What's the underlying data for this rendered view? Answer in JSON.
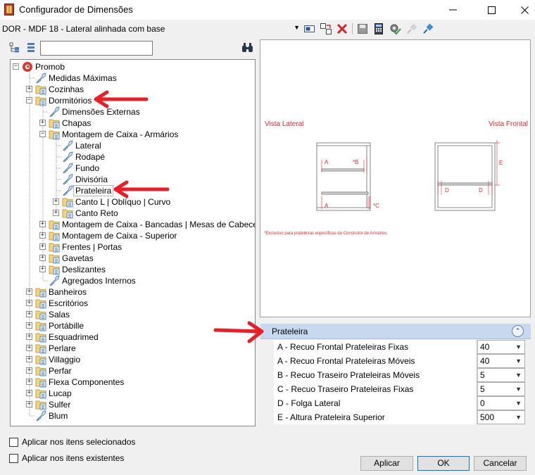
{
  "window": {
    "title": "Configurador de Dimensões",
    "minimize_glyph": "—",
    "maximize_glyph": "☐",
    "close_glyph": "✕"
  },
  "toolbar": {
    "combo_value": "DOR - MDF 18 - Lateral alinhada com base",
    "combo_arrow": "▼",
    "icons": [
      "view-icon",
      "swap-icon",
      "delete-icon",
      "save-icon",
      "calculator-icon",
      "settings-check-icon",
      "pin-disabled-icon",
      "pin-icon"
    ]
  },
  "tree_toolbar": {
    "expand_icon": "tree-expand-icon",
    "collapse_icon": "tree-collapse-icon",
    "search_value": "",
    "find_icon": "binoculars-icon"
  },
  "tree": [
    {
      "label": "Promob",
      "level": 0,
      "icon": "promob-logo",
      "expander": "-"
    },
    {
      "label": "Medidas Máximas",
      "level": 1,
      "icon": "tag",
      "expander": ""
    },
    {
      "label": "Cozinhas",
      "level": 1,
      "icon": "folder",
      "expander": "+"
    },
    {
      "label": "Dormitórios",
      "level": 1,
      "icon": "folder",
      "expander": "-"
    },
    {
      "label": "Dimensões Externas",
      "level": 2,
      "icon": "tag",
      "expander": ""
    },
    {
      "label": "Chapas",
      "level": 2,
      "icon": "folder",
      "expander": "+"
    },
    {
      "label": "Montagem de Caixa - Armários",
      "level": 2,
      "icon": "folder",
      "expander": "-"
    },
    {
      "label": "Lateral",
      "level": 3,
      "icon": "tag",
      "expander": ""
    },
    {
      "label": "Rodapé",
      "level": 3,
      "icon": "tag",
      "expander": ""
    },
    {
      "label": "Fundo",
      "level": 3,
      "icon": "tag",
      "expander": ""
    },
    {
      "label": "Divisória",
      "level": 3,
      "icon": "tag",
      "expander": ""
    },
    {
      "label": "Prateleira",
      "level": 3,
      "icon": "tag",
      "expander": "",
      "selected": true
    },
    {
      "label": "Canto L | Oblíquo | Curvo",
      "level": 3,
      "icon": "folder",
      "expander": "+"
    },
    {
      "label": "Canto Reto",
      "level": 3,
      "icon": "folder",
      "expander": "+"
    },
    {
      "label": "Montagem de Caixa - Bancadas | Mesas de Cabeceira",
      "level": 2,
      "icon": "folder",
      "expander": "+"
    },
    {
      "label": "Montagem de Caixa - Superior",
      "level": 2,
      "icon": "folder",
      "expander": "+"
    },
    {
      "label": "Frentes | Portas",
      "level": 2,
      "icon": "folder",
      "expander": "+"
    },
    {
      "label": "Gavetas",
      "level": 2,
      "icon": "folder",
      "expander": "+"
    },
    {
      "label": "Deslizantes",
      "level": 2,
      "icon": "folder",
      "expander": "+"
    },
    {
      "label": "Agregados Internos",
      "level": 2,
      "icon": "tag",
      "expander": ""
    },
    {
      "label": "Banheiros",
      "level": 1,
      "icon": "folder",
      "expander": "+"
    },
    {
      "label": "Escritórios",
      "level": 1,
      "icon": "folder",
      "expander": "+"
    },
    {
      "label": "Salas",
      "level": 1,
      "icon": "folder",
      "expander": "+"
    },
    {
      "label": "Portábille",
      "level": 1,
      "icon": "folder",
      "expander": "+"
    },
    {
      "label": "Esquadrimed",
      "level": 1,
      "icon": "folder",
      "expander": "+"
    },
    {
      "label": "Perlare",
      "level": 1,
      "icon": "folder",
      "expander": "+"
    },
    {
      "label": "Villaggio",
      "level": 1,
      "icon": "folder",
      "expander": "+"
    },
    {
      "label": "Perfar",
      "level": 1,
      "icon": "folder",
      "expander": "+"
    },
    {
      "label": "Flexa Componentes",
      "level": 1,
      "icon": "folder",
      "expander": "+"
    },
    {
      "label": "Lucap",
      "level": 1,
      "icon": "folder",
      "expander": "+"
    },
    {
      "label": "Sulfer",
      "level": 1,
      "icon": "folder",
      "expander": "+"
    },
    {
      "label": "Blum",
      "level": 1,
      "icon": "tag",
      "expander": ""
    }
  ],
  "preview": {
    "label_side": "Vista Lateral",
    "label_front": "Vista Frontal",
    "footnote": "*Exclusivo para prateleiras específicas do Construtor de Armários.",
    "dim_a_top": "A",
    "dim_b": "*B",
    "dim_a_bottom": "A",
    "dim_c": "*C",
    "dim_d_left": "D",
    "dim_d_right": "D",
    "dim_e": "E",
    "accent_color": "#e0282e"
  },
  "props": {
    "title": "Prateleira",
    "collapse_glyph": "⌃",
    "dropdown_glyph": "▼",
    "rows": [
      {
        "name": "A - Recuo Frontal Prateleiras Fixas",
        "value": "40"
      },
      {
        "name": "A - Recuo Frontal Prateleiras Móveis",
        "value": "40"
      },
      {
        "name": "B - Recuo Traseiro Prateleiras Móveis",
        "value": "5"
      },
      {
        "name": "C - Recuo Traseiro Prateleiras Fixas",
        "value": "5"
      },
      {
        "name": "D - Folga Lateral",
        "value": "0"
      },
      {
        "name": "E - Altura Prateleira Superior",
        "value": "500"
      }
    ]
  },
  "options": {
    "apply_selected": "Aplicar nos itens selecionados",
    "apply_existing": "Aplicar nos itens existentes"
  },
  "buttons": {
    "apply": "Aplicar",
    "ok": "OK",
    "cancel": "Cancelar"
  },
  "annotation_color": "#ee1c24"
}
